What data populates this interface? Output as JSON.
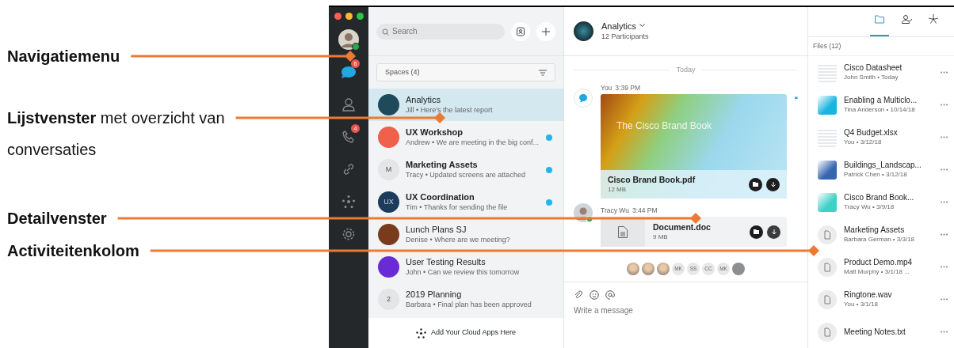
{
  "callouts": [
    {
      "text": "Navigatiemenu",
      "bold": true
    },
    {
      "text": "**Lijstvenster** met overzicht van conversaties",
      "bold": false
    },
    {
      "text": "Detailvenster",
      "bold": true
    },
    {
      "text": "Activiteitenkolom",
      "bold": true
    }
  ],
  "sidebar": {
    "items": [
      {
        "kind": "avatar",
        "online": true
      },
      {
        "kind": "messages",
        "badge": "6",
        "selected": true
      },
      {
        "kind": "people",
        "selected": false
      },
      {
        "kind": "calls",
        "badge": "4",
        "selected": false
      },
      {
        "kind": "link",
        "selected": false
      },
      {
        "kind": "apps",
        "selected": false
      },
      {
        "kind": "settings",
        "selected": false
      }
    ]
  },
  "list": {
    "search": {
      "placeholder": "Search"
    },
    "filter": "Spaces (4)",
    "spaces": [
      {
        "title": "Analytics",
        "snippet": "Jill • Here's the latest report",
        "unread": false,
        "selected": true,
        "avatar": {
          "kind": "photo",
          "color": "#1f4a5c"
        }
      },
      {
        "title": "UX Workshop",
        "snippet": "Andrew • We are meeting in the big conf...",
        "unread": true,
        "selected": false,
        "avatar": {
          "kind": "photo",
          "color": "#f0604a"
        }
      },
      {
        "title": "Marketing Assets",
        "snippet": "Tracy • Updated screens are attached",
        "unread": true,
        "selected": false,
        "avatar": {
          "kind": "initials",
          "text": "M"
        }
      },
      {
        "title": "UX Coordination",
        "snippet": "Tim • Thanks for sending the file",
        "unread": true,
        "selected": false,
        "avatar": {
          "kind": "initials",
          "text": "UX",
          "color": "#1d3c5c"
        }
      },
      {
        "title": "Lunch Plans SJ",
        "snippet": "Denise • Where are we meeting?",
        "unread": false,
        "selected": false,
        "avatar": {
          "kind": "photo",
          "color": "#7a3a1c"
        }
      },
      {
        "title": "User Testing Results",
        "snippet": "John • Can we review this tomorrow",
        "unread": false,
        "selected": false,
        "avatar": {
          "kind": "photo",
          "color": "#6a2bd6"
        }
      },
      {
        "title": "2019 Planning",
        "snippet": "Barbara • Final plan has been approved",
        "unread": false,
        "selected": false,
        "avatar": {
          "kind": "initials",
          "text": "2"
        }
      }
    ],
    "footer": "Add Your Cloud Apps Here"
  },
  "chat": {
    "title": "Analytics",
    "subtitle": "12 Participants",
    "tabs": [
      {
        "kind": "files",
        "selected": true
      },
      {
        "kind": "people",
        "selected": false
      },
      {
        "kind": "apps",
        "selected": false
      }
    ],
    "divider": "Today",
    "messages": [
      {
        "sender": "You",
        "time": "3:39 PM",
        "avatar": {
          "kind": "self"
        },
        "flagged": true,
        "attachment": {
          "kind": "preview",
          "preview_title": "The Cisco Brand Book",
          "name": "Cisco Brand Book.pdf",
          "size": "12 MB"
        }
      },
      {
        "sender": "Tracy Wu",
        "time": "3:44 PM",
        "avatar": {
          "kind": "photo"
        },
        "flagged": false,
        "attachment": {
          "kind": "doc",
          "name": "Document.doc",
          "size": "9 MB"
        }
      }
    ],
    "read_by": [
      {
        "kind": "photo"
      },
      {
        "kind": "photo"
      },
      {
        "kind": "photo"
      },
      {
        "kind": "initials",
        "text": "MK"
      },
      {
        "kind": "initials",
        "text": "SS"
      },
      {
        "kind": "initials",
        "text": "CC"
      },
      {
        "kind": "initials",
        "text": "MK"
      },
      {
        "kind": "more"
      }
    ],
    "composer": {
      "placeholder": "Write a message"
    }
  },
  "files": {
    "header": "Files (12)",
    "items": [
      {
        "name": "Cisco Datasheet",
        "meta": "John Smith • Today",
        "thumb": {
          "kind": "sheet"
        }
      },
      {
        "name": "Enabling a Multiclo...",
        "meta": "Tina Anderson • 10/14/18",
        "thumb": {
          "kind": "image",
          "color": "#1ab4e0"
        }
      },
      {
        "name": "Q4 Budget.xlsx",
        "meta": "You • 3/12/18",
        "thumb": {
          "kind": "sheet"
        }
      },
      {
        "name": "Buildings_Landscap...",
        "meta": "Patrick Chen • 3/12/18",
        "thumb": {
          "kind": "image",
          "color": "#3566b0"
        }
      },
      {
        "name": "Cisco Brand Book...",
        "meta": "Tracy Wu • 3/9/18",
        "thumb": {
          "kind": "image",
          "color": "#3fd0c8"
        }
      },
      {
        "name": "Marketing Assets",
        "meta": "Barbara German • 3/3/18",
        "thumb": {
          "kind": "doc"
        }
      },
      {
        "name": "Product Demo.mp4",
        "meta": "Matt Murphy • 3/1/18 ...",
        "thumb": {
          "kind": "doc"
        }
      },
      {
        "name": "Ringtone.wav",
        "meta": "You • 3/1/18",
        "thumb": {
          "kind": "doc"
        }
      },
      {
        "name": "Meeting Notes.txt",
        "thumb": {
          "kind": "doc"
        }
      }
    ]
  }
}
